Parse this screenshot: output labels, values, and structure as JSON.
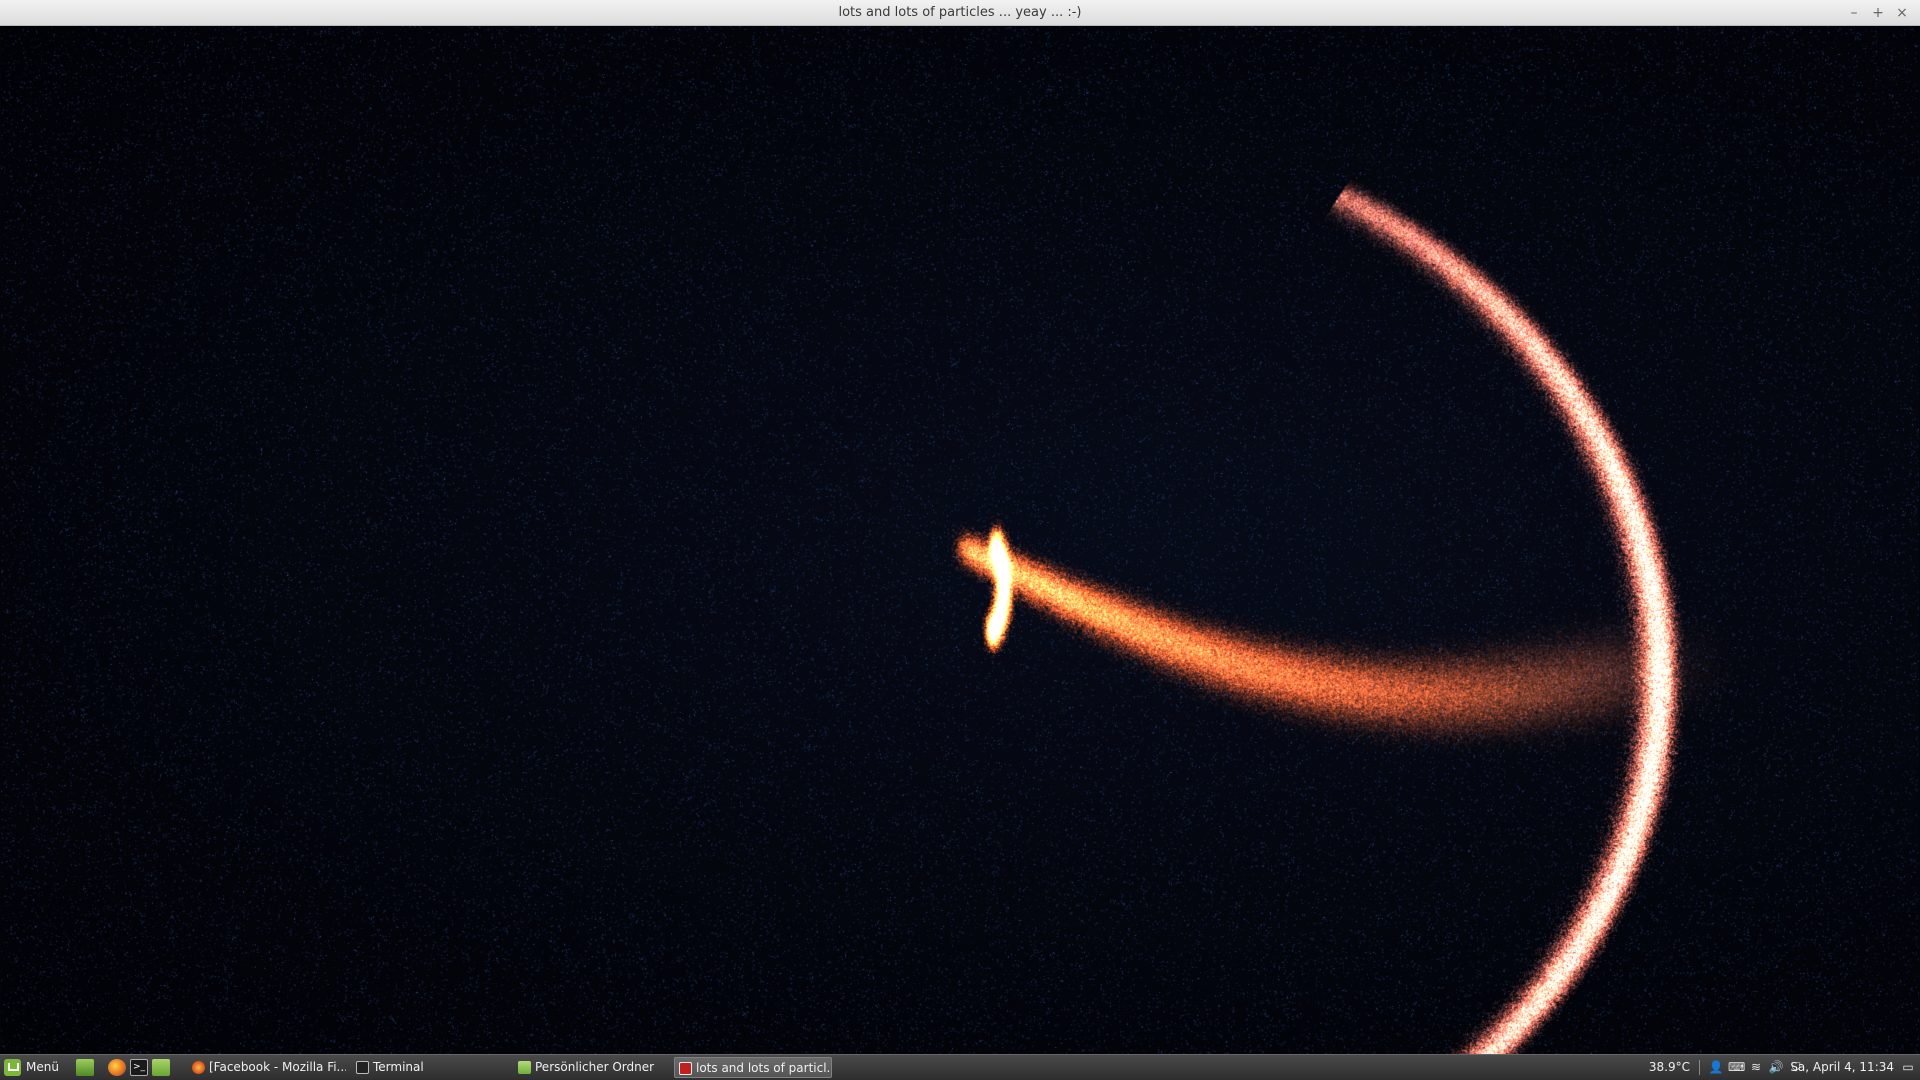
{
  "window": {
    "title": "lots and lots of particles ... yeay ... :-)",
    "controls": {
      "minimize": "–",
      "maximize": "+",
      "close": "×"
    }
  },
  "taskbar": {
    "menu_label": "Menü",
    "launchers": [
      "desktop-icon",
      "firefox-icon",
      "terminal-icon",
      "folder-icon"
    ],
    "tasks": [
      {
        "label": "[Facebook - Mozilla Fi...",
        "icon": "firefox-icon"
      },
      {
        "label": "Terminal",
        "icon": "terminal-icon"
      },
      {
        "label": "Persönlicher Ordner",
        "icon": "folder-icon"
      },
      {
        "label": "lots and lots of particl...",
        "icon": "app-icon",
        "active": true
      }
    ],
    "tray": {
      "temperature": "38.9°C",
      "icons": [
        "user-icon",
        "keyboard-icon",
        "wifi-icon",
        "volume-icon",
        "shield-icon"
      ],
      "clock": "Sa, April 4, 11:34",
      "show_desktop_icon": "show-desktop-icon"
    }
  },
  "colors": {
    "background": "#02040a",
    "particle_blue": "#3b6fb0",
    "particle_orange": "#e85a2a",
    "particle_salmon": "#ff8a7a"
  }
}
